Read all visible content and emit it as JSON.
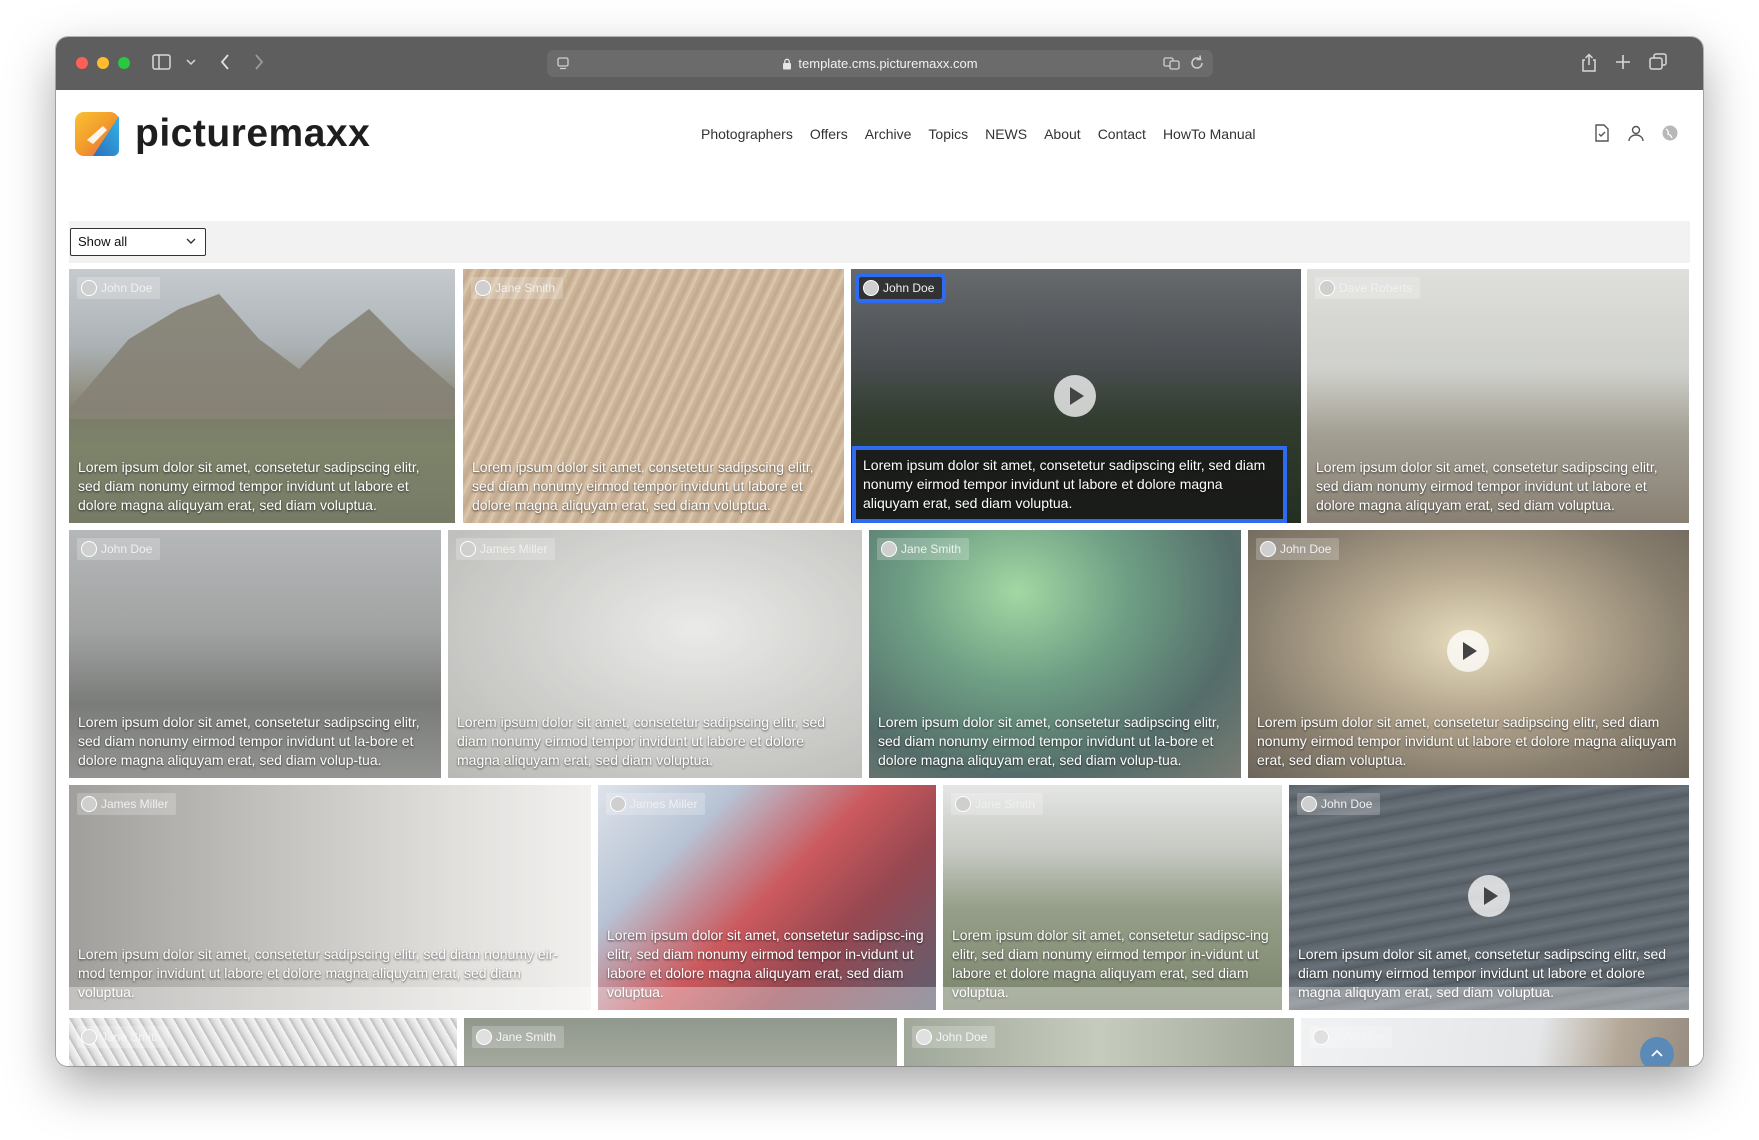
{
  "browser": {
    "url": "template.cms.picturemaxx.com"
  },
  "site": {
    "brand": "picturemaxx",
    "nav": [
      "Photographers",
      "Offers",
      "Archive",
      "Topics",
      "NEWS",
      "About",
      "Contact",
      "HowTo Manual"
    ],
    "filter_value": "Show all"
  },
  "tiles": [
    {
      "author": "John Doe",
      "caption": "Lorem ipsum dolor sit amet, consetetur sadipscing elitr, sed diam nonumy eirmod tempor invidunt ut labore et dolore magna aliquyam erat, sed diam voluptua."
    },
    {
      "author": "Jane Smith",
      "caption": "Lorem ipsum dolor sit amet, consetetur sadipscing elitr, sed diam nonumy eirmod tempor invidunt ut labore et dolore magna aliquyam erat, sed diam voluptua."
    },
    {
      "author": "John Doe",
      "caption": "Lorem ipsum dolor sit amet, consetetur sadipscing elitr, sed diam nonumy eirmod tempor invidunt ut labore et dolore magna aliquyam erat, sed diam voluptua."
    },
    {
      "author": "Dave Roberts",
      "caption": "Lorem ipsum dolor sit amet, consetetur sadipscing elitr, sed diam nonumy eirmod tempor invidunt ut labore et dolore magna aliquyam erat, sed diam voluptua."
    },
    {
      "author": "John Doe",
      "caption": "Lorem ipsum dolor sit amet, consetetur sadipscing elitr, sed diam nonumy eirmod tempor invidunt ut la-bore et dolore magna aliquyam erat, sed diam volup-tua."
    },
    {
      "author": "James Miller",
      "caption": "Lorem ipsum dolor sit amet, consetetur sadipscing elitr, sed diam nonumy eirmod tempor invidunt ut labore et dolore magna aliquyam erat, sed diam voluptua."
    },
    {
      "author": "Jane Smith",
      "caption": "Lorem ipsum dolor sit amet, consetetur sadipscing elitr, sed diam nonumy eirmod tempor invidunt ut la-bore et dolore magna aliquyam erat, sed diam volup-tua."
    },
    {
      "author": "John Doe",
      "caption": "Lorem ipsum dolor sit amet, consetetur sadipscing elitr, sed diam nonumy eirmod tempor invidunt ut labore et dolore magna aliquyam erat, sed diam voluptua."
    },
    {
      "author": "James Miller",
      "caption": "Lorem ipsum dolor sit amet, consetetur sadipscing elitr, sed diam nonumy eir-mod tempor invidunt ut labore et dolore magna aliquyam erat, sed diam voluptua."
    },
    {
      "author": "James Miller",
      "caption": "Lorem ipsum dolor sit amet, consetetur sadipsc-ing elitr, sed diam nonumy eirmod tempor in-vidunt ut labore et dolore magna aliquyam erat, sed diam voluptua."
    },
    {
      "author": "Jane Smith",
      "caption": "Lorem ipsum dolor sit amet, consetetur sadipsc-ing elitr, sed diam nonumy eirmod tempor in-vidunt ut labore et dolore magna aliquyam erat, sed diam voluptua."
    },
    {
      "author": "John Doe",
      "caption": "Lorem ipsum dolor sit amet, consetetur sadipscing elitr, sed diam nonumy eirmod tempor invidunt ut labore et dolore magna aliquyam erat, sed diam voluptua."
    },
    {
      "author": "Jane Smith",
      "caption": ""
    },
    {
      "author": "Jane Smith",
      "caption": ""
    },
    {
      "author": "John Doe",
      "caption": ""
    },
    {
      "author": "John Doe",
      "caption": ""
    }
  ]
}
